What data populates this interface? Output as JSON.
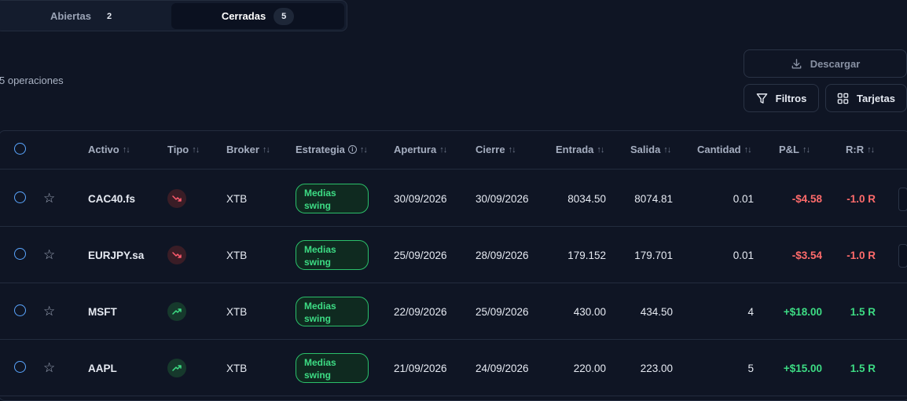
{
  "tabs": [
    {
      "label": "Abiertas",
      "count": "2",
      "active": false
    },
    {
      "label": "Cerradas",
      "count": "5",
      "active": true
    }
  ],
  "summary": {
    "operations_label": "5 operaciones"
  },
  "toolbar": {
    "download_label": "Descargar",
    "filters_label": "Filtros",
    "cards_label": "Tarjetas"
  },
  "table": {
    "headers": {
      "asset": "Activo",
      "type": "Tipo",
      "broker": "Broker",
      "strategy": "Estrategia",
      "open": "Apertura",
      "close": "Cierre",
      "entry": "Entrada",
      "exit": "Salida",
      "quantity": "Cantidad",
      "pnl": "P&L",
      "rr": "R:R"
    },
    "rows": [
      {
        "asset": "CAC40.fs",
        "type": "down",
        "broker": "XTB",
        "strategy": "Medias swing",
        "open": "30/09/2026",
        "close": "30/09/2026",
        "entry": "8034.50",
        "exit": "8074.81",
        "quantity": "0.01",
        "pnl": "-$4.58",
        "rr": "-1.0 R"
      },
      {
        "asset": "EURJPY.sa",
        "type": "down",
        "broker": "XTB",
        "strategy": "Medias swing",
        "open": "25/09/2026",
        "close": "28/09/2026",
        "entry": "179.152",
        "exit": "179.701",
        "quantity": "0.01",
        "pnl": "-$3.54",
        "rr": "-1.0 R"
      },
      {
        "asset": "MSFT",
        "type": "up",
        "broker": "XTB",
        "strategy": "Medias swing",
        "open": "22/09/2026",
        "close": "25/09/2026",
        "entry": "430.00",
        "exit": "434.50",
        "quantity": "4",
        "pnl": "+$18.00",
        "rr": "1.5 R"
      },
      {
        "asset": "AAPL",
        "type": "up",
        "broker": "XTB",
        "strategy": "Medias swing",
        "open": "21/09/2026",
        "close": "24/09/2026",
        "entry": "220.00",
        "exit": "223.00",
        "quantity": "5",
        "pnl": "+$15.00",
        "rr": "1.5 R"
      }
    ]
  },
  "colors": {
    "background": "#0f1524",
    "negative": "#ff6b6b",
    "positive": "#3ddc84",
    "accent": "#5aa6ff"
  }
}
